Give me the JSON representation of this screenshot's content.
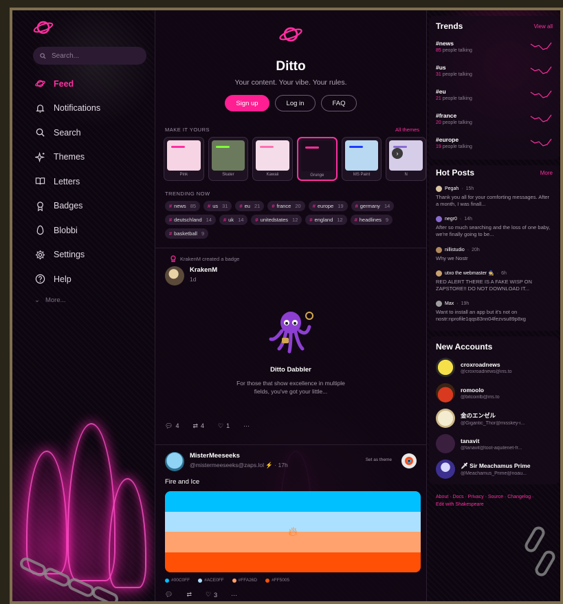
{
  "sidebar": {
    "search_placeholder": "Search...",
    "items": [
      {
        "label": "Feed",
        "icon": "feed-icon",
        "active": true
      },
      {
        "label": "Notifications",
        "icon": "bell-icon"
      },
      {
        "label": "Search",
        "icon": "search-icon"
      },
      {
        "label": "Themes",
        "icon": "sparkle-icon"
      },
      {
        "label": "Letters",
        "icon": "book-icon"
      },
      {
        "label": "Badges",
        "icon": "medal-icon"
      },
      {
        "label": "Blobbi",
        "icon": "egg-icon"
      },
      {
        "label": "Settings",
        "icon": "gear-icon"
      },
      {
        "label": "Help",
        "icon": "help-icon"
      }
    ],
    "more_label": "More..."
  },
  "hero": {
    "title": "Ditto",
    "tagline": "Your content. Your vibe. Your rules.",
    "signup": "Sign up",
    "login": "Log in",
    "faq": "FAQ"
  },
  "themes": {
    "heading": "MAKE IT YOURS",
    "link": "All themes",
    "cards": [
      {
        "label": "Pink",
        "bg": "#f7d4e4",
        "bar": "#ff2fa0"
      },
      {
        "label": "Skater",
        "bg": "#6b7a5c",
        "bar": "#7fff3a"
      },
      {
        "label": "Kawaii",
        "bg": "#f4dde9",
        "bar": "#ff6fb3"
      },
      {
        "label": "Grunge",
        "bg": "#1a0c1c",
        "bar": "#ff2fa0",
        "selected": true
      },
      {
        "label": "MS Paint",
        "bg": "#b9d8f2",
        "bar": "#1a3cff"
      },
      {
        "label": "N",
        "bg": "#d6cde9",
        "bar": "#8a6bd1"
      }
    ]
  },
  "trending": {
    "heading": "TRENDING NOW",
    "tags": [
      {
        "name": "news",
        "count": "85"
      },
      {
        "name": "us",
        "count": "31"
      },
      {
        "name": "eu",
        "count": "21"
      },
      {
        "name": "france",
        "count": "20"
      },
      {
        "name": "europe",
        "count": "19"
      },
      {
        "name": "germany",
        "count": "14"
      },
      {
        "name": "deutschland",
        "count": "14"
      },
      {
        "name": "uk",
        "count": "14"
      },
      {
        "name": "unitedstates",
        "count": "12"
      },
      {
        "name": "england",
        "count": "12"
      },
      {
        "name": "headlines",
        "count": "9"
      },
      {
        "name": "basketball",
        "count": "9"
      }
    ]
  },
  "post1": {
    "context": "KrakenM created a badge",
    "author": "KrakenM",
    "time": "1d",
    "badge_title": "Ditto Dabbler",
    "badge_desc": "For those that show excellence in multiple fields, you've got your little...",
    "replies": "4",
    "reposts": "4",
    "likes": "1"
  },
  "post2": {
    "author": "MisterMeeseeks",
    "handle": "@mistermeeseeks@zaps.lol",
    "time": "17h",
    "set_theme": "Set as theme",
    "text": "Fire and Ice",
    "colors": [
      {
        "hex": "#00C0FF",
        "label": "#00C0FF"
      },
      {
        "hex": "#ACE0FF",
        "label": "#ACE0FF"
      },
      {
        "hex": "#FFA26D",
        "label": "#FFA26D"
      },
      {
        "hex": "#FF5005",
        "label": "#FF5005"
      }
    ],
    "likes": "3"
  },
  "trends": {
    "title": "Trends",
    "link": "View all",
    "items": [
      {
        "tag": "#news",
        "count": "85",
        "suffix": "people talking"
      },
      {
        "tag": "#us",
        "count": "31",
        "suffix": "people talking"
      },
      {
        "tag": "#eu",
        "count": "21",
        "suffix": "people talking"
      },
      {
        "tag": "#france",
        "count": "20",
        "suffix": "people talking"
      },
      {
        "tag": "#europe",
        "count": "19",
        "suffix": "people talking"
      }
    ]
  },
  "hot_posts": {
    "title": "Hot Posts",
    "link": "More",
    "items": [
      {
        "author": "Pegah",
        "time": "15h",
        "text": "Thank you all for your comforting messages. After a month, I was finall..."
      },
      {
        "author": "negr0",
        "time": "14h",
        "text": "After so much searching and the loss of one baby, we're finally going to be..."
      },
      {
        "author": "nillistudio",
        "time": "20h",
        "text": "Why we Nostr"
      },
      {
        "author": "utxo the webmaster 🧙",
        "time": "6h",
        "text": "RED ALERT THERE IS A FAKE WISP ON ZAPSTORE!! DO NOT DOWNLOAD IT..."
      },
      {
        "author": "Max",
        "time": "19h",
        "text": "Want to install an app but it's not on nostr:nprofile1qqs83nn04fezvsu89p8xg"
      }
    ]
  },
  "new_accounts": {
    "title": "New Accounts",
    "items": [
      {
        "name": "croxroadnews",
        "handle": "@croxroadnews@iris.to"
      },
      {
        "name": "romoolo",
        "handle": "@bitcoinlb@iris.to"
      },
      {
        "name": "金のエンゼル",
        "handle": "@Gigantic_Thor@misskey-i..."
      },
      {
        "name": "tanavit",
        "handle": "@tanavit@toot-aquilenet-fr..."
      },
      {
        "name": "🗡 Sir Meachamus Prime",
        "handle": "@Meachamus_Prime@noau..."
      }
    ]
  },
  "footer": {
    "line1": "About · Docs · Privacy · Source · Changelog ·",
    "line2": "Edit with Shakespeare"
  }
}
